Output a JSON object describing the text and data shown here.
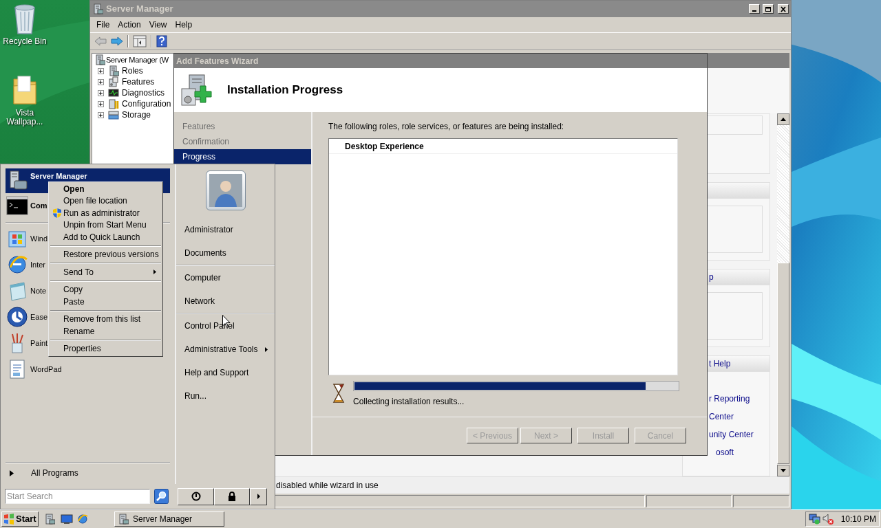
{
  "desktop_icons": [
    {
      "label": "Recycle Bin",
      "kind": "bin"
    },
    {
      "label": "Vista Wallpap...",
      "kind": "folder"
    }
  ],
  "server_manager": {
    "title": "Server Manager",
    "menu": [
      "File",
      "Action",
      "View",
      "Help"
    ],
    "tree": {
      "label": "Server Manager (W",
      "children": [
        {
          "label": "Roles",
          "kind": "roles",
          "expanded": false
        },
        {
          "label": "Features",
          "kind": "features",
          "expanded": false
        },
        {
          "label": "Diagnostics",
          "kind": "diagnostics",
          "expanded": false
        },
        {
          "label": "Configuration",
          "kind": "configuration",
          "expanded": false
        },
        {
          "label": "Storage",
          "kind": "storage",
          "expanded": false
        }
      ]
    },
    "sections": [
      {
        "kind": "plain"
      },
      {
        "kind": "panel"
      },
      {
        "kind": "panel",
        "title": "p"
      },
      {
        "kind": "panel",
        "title": "t Help",
        "links": [
          "r Reporting",
          "Center",
          "unity Center",
          "osoft"
        ]
      }
    ],
    "footer": "disabled while wizard in use"
  },
  "wizard": {
    "title": "Add Features Wizard",
    "heading": "Installation Progress",
    "steps": [
      {
        "label": "Features",
        "selected": false
      },
      {
        "label": "Confirmation",
        "selected": false
      },
      {
        "label": "Progress",
        "selected": true
      }
    ],
    "intro": "The following roles, role services, or features are being installed:",
    "items": [
      "Desktop Experience"
    ],
    "progress": {
      "level": 0.9
    },
    "status": "Collecting installation results...",
    "buttons": [
      {
        "label": "< Previous",
        "disabled": true
      },
      {
        "label": "Next >",
        "disabled": true
      },
      {
        "label": "Install",
        "disabled": true
      },
      {
        "label": "Cancel",
        "disabled": true
      }
    ]
  },
  "start_menu": {
    "pinned": [
      {
        "label": "Server Manager",
        "kind": "server",
        "selected": true
      },
      {
        "label": "Com",
        "kind": "cmd",
        "selected": false
      }
    ],
    "recent": [
      {
        "label": "Wind",
        "kind": "update"
      },
      {
        "label": "Inter",
        "kind": "browser"
      },
      {
        "label": "Note",
        "kind": "notepad"
      },
      {
        "label": "Ease",
        "kind": "ease"
      },
      {
        "label": "Paint",
        "kind": "paint"
      },
      {
        "label": "WordPad",
        "kind": "wordpad"
      }
    ],
    "all_programs": "All Programs",
    "search": {
      "placeholder": "Start Search"
    },
    "links": [
      [
        {
          "label": "Administrator",
          "submenu": false
        },
        {
          "label": "Documents",
          "submenu": false
        }
      ],
      [
        {
          "label": "Computer",
          "submenu": false
        },
        {
          "label": "Network",
          "submenu": false
        }
      ],
      [
        {
          "label": "Control Panel",
          "submenu": false
        },
        {
          "label": "Administrative Tools",
          "submenu": true
        },
        {
          "label": "Help and Support",
          "submenu": false
        },
        {
          "label": "Run...",
          "submenu": false
        }
      ]
    ]
  },
  "context_menu": {
    "groups": [
      [
        {
          "label": "Open",
          "default": true,
          "elevated": false,
          "submenu": false
        },
        {
          "label": "Open file location",
          "default": false,
          "elevated": false,
          "submenu": false
        },
        {
          "label": "Run as administrator",
          "default": false,
          "elevated": true,
          "submenu": false
        },
        {
          "label": "Unpin from Start Menu",
          "default": false,
          "elevated": false,
          "submenu": false
        },
        {
          "label": "Add to Quick Launch",
          "default": false,
          "elevated": false,
          "submenu": false
        }
      ],
      [
        {
          "label": "Restore previous versions",
          "default": false,
          "elevated": false,
          "submenu": false
        }
      ],
      [
        {
          "label": "Send To",
          "default": false,
          "elevated": false,
          "submenu": true
        }
      ],
      [
        {
          "label": "Copy",
          "default": false,
          "elevated": false,
          "submenu": false
        },
        {
          "label": "Paste",
          "default": false,
          "elevated": false,
          "submenu": false
        }
      ],
      [
        {
          "label": "Remove from this list",
          "default": false,
          "elevated": false,
          "submenu": false
        },
        {
          "label": "Rename",
          "default": false,
          "elevated": false,
          "submenu": false
        }
      ],
      [
        {
          "label": "Properties",
          "default": false,
          "elevated": false,
          "submenu": false
        }
      ]
    ]
  },
  "taskbar": {
    "start": "Start",
    "tasks": [
      "Server Manager"
    ],
    "clock": "10:10 PM"
  }
}
